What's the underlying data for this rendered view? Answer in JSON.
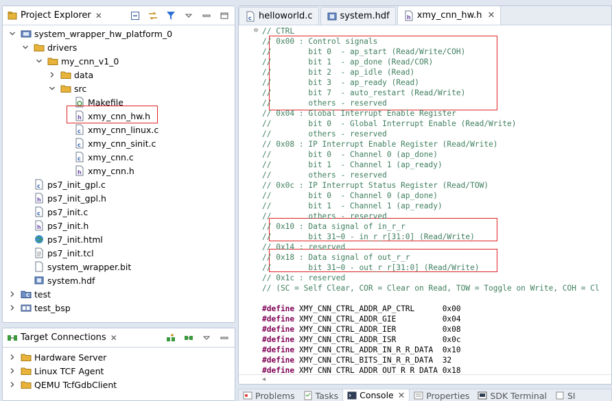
{
  "project_explorer": {
    "title": "Project Explorer",
    "items": [
      {
        "label": "system_wrapper_hw_platform_0",
        "level": 0,
        "twisty": "open",
        "icon": "hw-platform-icon"
      },
      {
        "label": "drivers",
        "level": 1,
        "twisty": "open",
        "icon": "folder-icon"
      },
      {
        "label": "my_cnn_v1_0",
        "level": 2,
        "twisty": "open",
        "icon": "folder-icon"
      },
      {
        "label": "data",
        "level": 3,
        "twisty": "closed",
        "icon": "folder-icon"
      },
      {
        "label": "src",
        "level": 3,
        "twisty": "open",
        "icon": "folder-icon"
      },
      {
        "label": "Makefile",
        "level": 4,
        "twisty": "none",
        "icon": "makefile-icon"
      },
      {
        "label": "xmy_cnn_hw.h",
        "level": 4,
        "twisty": "none",
        "icon": "header-file-icon"
      },
      {
        "label": "xmy_cnn_linux.c",
        "level": 4,
        "twisty": "none",
        "icon": "c-file-icon"
      },
      {
        "label": "xmy_cnn_sinit.c",
        "level": 4,
        "twisty": "none",
        "icon": "c-file-icon"
      },
      {
        "label": "xmy_cnn.c",
        "level": 4,
        "twisty": "none",
        "icon": "c-file-icon"
      },
      {
        "label": "xmy_cnn.h",
        "level": 4,
        "twisty": "none",
        "icon": "header-file-icon"
      },
      {
        "label": "ps7_init_gpl.c",
        "level": 1,
        "twisty": "none",
        "icon": "c-file-icon"
      },
      {
        "label": "ps7_init_gpl.h",
        "level": 1,
        "twisty": "none",
        "icon": "header-file-icon"
      },
      {
        "label": "ps7_init.c",
        "level": 1,
        "twisty": "none",
        "icon": "c-file-icon"
      },
      {
        "label": "ps7_init.h",
        "level": 1,
        "twisty": "none",
        "icon": "header-file-icon"
      },
      {
        "label": "ps7_init.html",
        "level": 1,
        "twisty": "none",
        "icon": "html-file-icon"
      },
      {
        "label": "ps7_init.tcl",
        "level": 1,
        "twisty": "none",
        "icon": "text-file-icon"
      },
      {
        "label": "system_wrapper.bit",
        "level": 1,
        "twisty": "none",
        "icon": "bit-file-icon"
      },
      {
        "label": "system.hdf",
        "level": 1,
        "twisty": "none",
        "icon": "hdf-file-icon"
      },
      {
        "label": "test",
        "level": 0,
        "twisty": "closed",
        "icon": "c-project-icon"
      },
      {
        "label": "test_bsp",
        "level": 0,
        "twisty": "closed",
        "icon": "bsp-project-icon"
      }
    ]
  },
  "target_connections": {
    "title": "Target Connections",
    "items": [
      {
        "label": "Hardware Server"
      },
      {
        "label": "Linux TCF Agent"
      },
      {
        "label": "QEMU TcfGdbClient"
      }
    ]
  },
  "editor": {
    "tabs": [
      {
        "label": "helloworld.c",
        "icon": "c-file-icon",
        "active": false
      },
      {
        "label": "system.hdf",
        "icon": "hdf-file-icon",
        "active": false
      },
      {
        "label": "xmy_cnn_hw.h",
        "icon": "header-file-icon",
        "active": true
      }
    ],
    "lines": [
      {
        "text": "// CTRL",
        "kind": "comment",
        "fold": true
      },
      {
        "text": "// 0x00 : Control signals",
        "kind": "comment"
      },
      {
        "text": "//        bit 0  - ap_start (Read/Write/COH)",
        "kind": "comment"
      },
      {
        "text": "//        bit 1  - ap_done (Read/COR)",
        "kind": "comment"
      },
      {
        "text": "//        bit 2  - ap_idle (Read)",
        "kind": "comment"
      },
      {
        "text": "//        bit 3  - ap_ready (Read)",
        "kind": "comment"
      },
      {
        "text": "//        bit 7  - auto_restart (Read/Write)",
        "kind": "comment"
      },
      {
        "text": "//        others - reserved",
        "kind": "comment"
      },
      {
        "text": "// 0x04 : Global Interrupt Enable Register",
        "kind": "comment"
      },
      {
        "text": "//        bit 0  - Global Interrupt Enable (Read/Write)",
        "kind": "comment"
      },
      {
        "text": "//        others - reserved",
        "kind": "comment"
      },
      {
        "text": "// 0x08 : IP Interrupt Enable Register (Read/Write)",
        "kind": "comment"
      },
      {
        "text": "//        bit 0  - Channel 0 (ap_done)",
        "kind": "comment"
      },
      {
        "text": "//        bit 1  - Channel 1 (ap_ready)",
        "kind": "comment"
      },
      {
        "text": "//        others - reserved",
        "kind": "comment"
      },
      {
        "text": "// 0x0c : IP Interrupt Status Register (Read/TOW)",
        "kind": "comment"
      },
      {
        "text": "//        bit 0  - Channel 0 (ap_done)",
        "kind": "comment"
      },
      {
        "text": "//        bit 1  - Channel 1 (ap_ready)",
        "kind": "comment"
      },
      {
        "text": "//        others - reserved",
        "kind": "comment"
      },
      {
        "text": "// 0x10 : Data signal of in_r_r",
        "kind": "comment"
      },
      {
        "text": "//        bit 31~0 - in_r_r[31:0] (Read/Write)",
        "kind": "comment"
      },
      {
        "text": "// 0x14 : reserved",
        "kind": "comment"
      },
      {
        "text": "// 0x18 : Data signal of out_r_r",
        "kind": "comment"
      },
      {
        "text": "//        bit 31~0 - out_r_r[31:0] (Read/Write)",
        "kind": "comment"
      },
      {
        "text": "// 0x1c : reserved",
        "kind": "comment"
      },
      {
        "text": "// (SC = Self Clear, COR = Clear on Read, TOW = Toggle on Write, COH = Cl",
        "kind": "comment"
      },
      {
        "text": "",
        "kind": "blank"
      },
      {
        "kind": "define",
        "keyword": "#define",
        "text": " XMY_CNN_CTRL_ADDR_AP_CTRL      0x00"
      },
      {
        "kind": "define",
        "keyword": "#define",
        "text": " XMY_CNN_CTRL_ADDR_GIE          0x04"
      },
      {
        "kind": "define",
        "keyword": "#define",
        "text": " XMY_CNN_CTRL_ADDR_IER          0x08"
      },
      {
        "kind": "define",
        "keyword": "#define",
        "text": " XMY_CNN_CTRL_ADDR_ISR          0x0c"
      },
      {
        "kind": "define",
        "keyword": "#define",
        "text": " XMY_CNN_CTRL_ADDR_IN_R_R_DATA  0x10"
      },
      {
        "kind": "define",
        "keyword": "#define",
        "text": " XMY_CNN_CTRL_BITS_IN_R_R_DATA  32"
      },
      {
        "kind": "define",
        "keyword": "#define",
        "text": " XMY_CNN_CTRL_ADDR_OUT_R_R_DATA 0x18"
      }
    ]
  },
  "bottom_tabs": [
    {
      "label": "Problems",
      "active": false,
      "icon": "problems-icon"
    },
    {
      "label": "Tasks",
      "active": false,
      "icon": "tasks-icon"
    },
    {
      "label": "Console",
      "active": true,
      "icon": "console-icon"
    },
    {
      "label": "Properties",
      "active": false,
      "icon": "properties-icon"
    },
    {
      "label": "SDK Terminal",
      "active": false,
      "icon": "terminal-icon"
    },
    {
      "label": "SI",
      "active": false,
      "icon": "view-icon"
    }
  ],
  "colors": {
    "comment": "#3f7f5f",
    "keyword": "#7f0055",
    "highlight_box": "#e02020",
    "folder": "#e8b33a"
  }
}
